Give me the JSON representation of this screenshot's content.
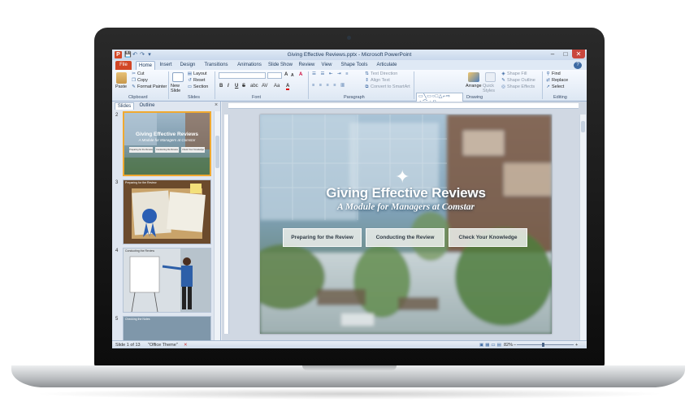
{
  "window": {
    "title": "Giving Effective Reviews.pptx - Microsoft PowerPoint",
    "app_icon_letter": "P",
    "qa_save": "💾",
    "qa_undo": "↶",
    "qa_redo": "↷",
    "qa_more": "▾",
    "minimize": "–",
    "maximize": "□",
    "close": "✕",
    "help": "?"
  },
  "ribbon_tabs": [
    "File",
    "Home",
    "Insert",
    "Design",
    "Transitions",
    "Animations",
    "Slide Show",
    "Review",
    "View",
    "Shape Tools",
    "Articulate"
  ],
  "ribbon": {
    "clipboard": {
      "label": "Clipboard",
      "paste": "Paste",
      "cut": "Cut",
      "copy": "Copy",
      "format_painter": "Format Painter"
    },
    "slides": {
      "label": "Slides",
      "new_slide": "New Slide",
      "layout": "Layout",
      "reset": "Reset",
      "section": "Section"
    },
    "font": {
      "label": "Font",
      "bold": "B",
      "italic": "I",
      "underline": "U",
      "strike": "S",
      "shadow": "abc",
      "spacing": "AV",
      "case": "Aa",
      "color": "A",
      "grow": "A",
      "shrink": "A",
      "clear": "A"
    },
    "paragraph": {
      "label": "Paragraph",
      "text_direction": "Text Direction",
      "align_text": "Align Text",
      "smartart": "Convert to SmartArt"
    },
    "drawing": {
      "label": "Drawing",
      "shapes_preview": "▭╲▭○□△⌐⇨ ◇⌒☆{}",
      "arrange": "Arrange",
      "quick_styles": "Quick Styles",
      "shape_fill": "Shape Fill",
      "shape_outline": "Shape Outline",
      "shape_effects": "Shape Effects"
    },
    "editing": {
      "label": "Editing",
      "find": "Find",
      "replace": "Replace",
      "select": "Select"
    }
  },
  "panel": {
    "tabs": [
      "Slides",
      "Outline"
    ],
    "close": "×",
    "slide_numbers": [
      "2",
      "3",
      "4",
      "5"
    ],
    "thumb2_title": "Giving Effective Reviews",
    "thumb2_sub": "A Module for Managers at Comstar",
    "thumb2_buttons": [
      "Preparing for the Review",
      "Conducting the Review",
      "Check Your Knowledge"
    ],
    "thumb3_header": "Preparing for the Review",
    "thumb4_header": "Conducting the Review",
    "thumb5_header": "Checking the Notes"
  },
  "slide": {
    "title": "Giving Effective Reviews",
    "subtitle": "A Module for Managers at Comstar",
    "buttons": [
      "Preparing for the Review",
      "Conducting the Review",
      "Check Your Knowledge"
    ]
  },
  "statusbar": {
    "slide_info": "Slide 1 of 13",
    "theme": "\"Office Theme\"",
    "zoom": "82%",
    "zoom_minus": "–",
    "zoom_plus": "+"
  },
  "colors": {
    "file_tab": "#d24726",
    "selection": "#f0a930",
    "ribbon_text": "#1e395b"
  }
}
